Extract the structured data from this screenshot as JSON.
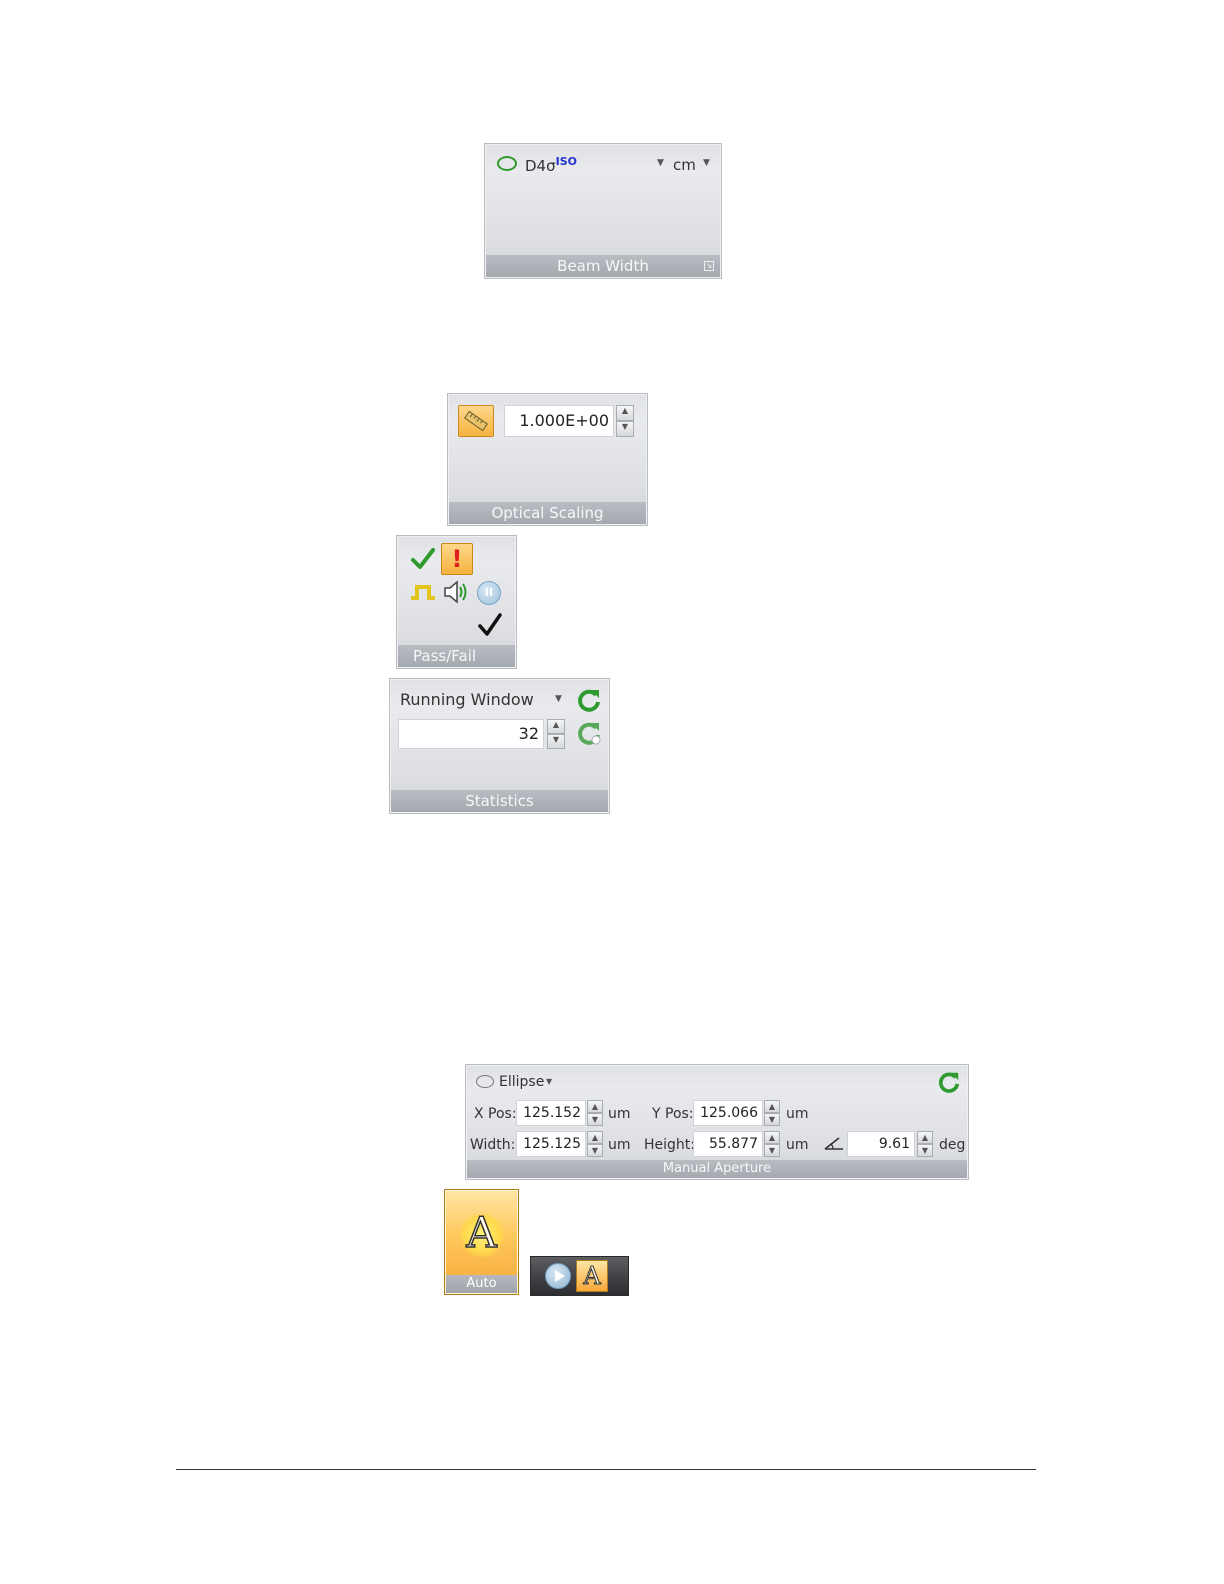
{
  "beam_width": {
    "method": "D4σ",
    "method_superscript": "ISO",
    "unit": "cm",
    "footer": "Beam Width"
  },
  "optical_scaling": {
    "value": "1.000E+00",
    "footer": "Optical Scaling"
  },
  "pass_fail": {
    "footer": "Pass/Fail"
  },
  "statistics": {
    "mode": "Running Window",
    "count": "32",
    "footer": "Statistics"
  },
  "manual_aperture": {
    "shape": "Ellipse",
    "x_pos_label": "X Pos:",
    "x_pos_value": "125.152",
    "y_pos_label": "Y Pos:",
    "y_pos_value": "125.066",
    "width_label": "Width:",
    "width_value": "125.125",
    "height_label": "Height:",
    "height_value": "55.877",
    "angle_value": "9.61",
    "unit_um": "um",
    "unit_deg": "deg",
    "footer": "Manual Aperture"
  },
  "auto": {
    "label": "Auto",
    "glyph": "A"
  },
  "colors": {
    "green": "#2f9a2f",
    "orange": "#f5a623",
    "iso_blue": "#2233cc"
  }
}
